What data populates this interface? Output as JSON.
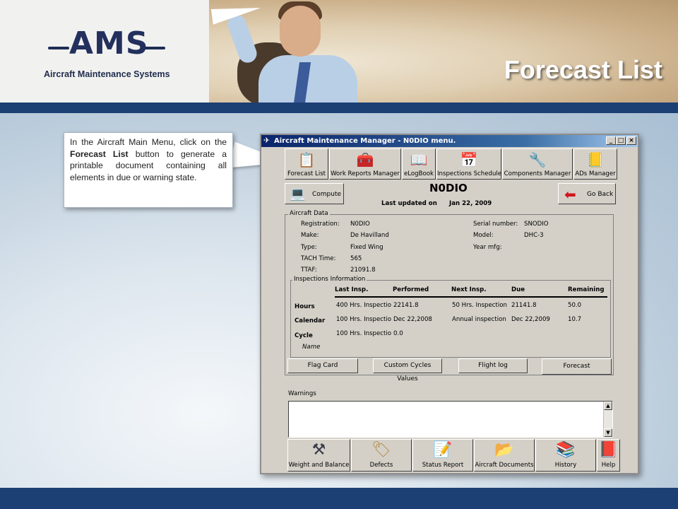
{
  "slide": {
    "logo_text": "AMS",
    "logo_subtitle": "Aircraft Maintenance Systems",
    "title": "Forecast List"
  },
  "callout": {
    "part1": "In the Aircraft Main Menu, click on the ",
    "bold": "Forecast List",
    "part2": " button to generate a printable document containing all elements in due or warning state."
  },
  "window": {
    "title": "Aircraft Maintenance Manager - N0DIO menu.",
    "controls": {
      "minimize": "_",
      "maximize": "□",
      "close": "×"
    }
  },
  "toolbar": [
    {
      "label": "Forecast List",
      "icon": "clipboard-icon"
    },
    {
      "label": "Work Reports Manager",
      "icon": "toolbox-icon"
    },
    {
      "label": "eLogBook",
      "icon": "logbook-icon"
    },
    {
      "label": "Inspections Schedule",
      "icon": "schedule-icon"
    },
    {
      "label": "Components Manager",
      "icon": "wrench-icon"
    },
    {
      "label": "ADs Manager",
      "icon": "notepad-icon"
    }
  ],
  "compute_label": "Compute",
  "go_back_label": "Go Back",
  "registration_heading": "N0DIO",
  "last_updated": {
    "label": "Last updated on",
    "value": "Jan 22, 2009"
  },
  "aircraft_data": {
    "legend": "Aircraft Data",
    "registration": {
      "label": "Registration:",
      "value": "N0DIO"
    },
    "make": {
      "label": "Make:",
      "value": "De Havilland"
    },
    "type": {
      "label": "Type:",
      "value": "Fixed Wing"
    },
    "tach": {
      "label": "TACH Time:",
      "value": "565"
    },
    "ttaf": {
      "label": "TTAF:",
      "value": "21091.8"
    },
    "serial": {
      "label": "Serial number:",
      "value": "SNODIO"
    },
    "model": {
      "label": "Model:",
      "value": "DHC-3"
    },
    "year": {
      "label": "Year mfg:",
      "value": ""
    }
  },
  "inspections": {
    "legend": "Inspections Information",
    "columns": [
      "Last Insp.",
      "Performed",
      "Next Insp.",
      "Due",
      "Remaining"
    ],
    "rows": [
      {
        "label": "Hours",
        "last": "400 Hrs. Inspectio",
        "performed": "22141.8",
        "next": "50 Hrs. Inspection",
        "due": "21141.8",
        "remaining": "50.0"
      },
      {
        "label": "Calendar",
        "last": "100 Hrs. Inspectio",
        "performed": "Dec 22,2008",
        "next": "Annual inspection",
        "due": "Dec 22,2009",
        "remaining": "10.7"
      },
      {
        "label": "Cycle",
        "last": "100 Hrs. Inspectio",
        "performed": "0.0",
        "next": "",
        "due": "",
        "remaining": ""
      }
    ],
    "name_label": "Name"
  },
  "action_buttons": [
    "Flag Card",
    "Custom Cycles Values",
    "Flight log",
    "Forecast"
  ],
  "warnings": {
    "label": "Warnings",
    "text": ""
  },
  "bottom_buttons": [
    {
      "label": "Weight and Balance",
      "icon": "anvil-icon"
    },
    {
      "label": "Defects",
      "icon": "tag-icon"
    },
    {
      "label": "Status Report",
      "icon": "report-icon"
    },
    {
      "label": "Aircraft Documents",
      "icon": "folder-icon"
    },
    {
      "label": "History",
      "icon": "book-icon"
    },
    {
      "label": "Help",
      "icon": "help-book-icon"
    }
  ]
}
